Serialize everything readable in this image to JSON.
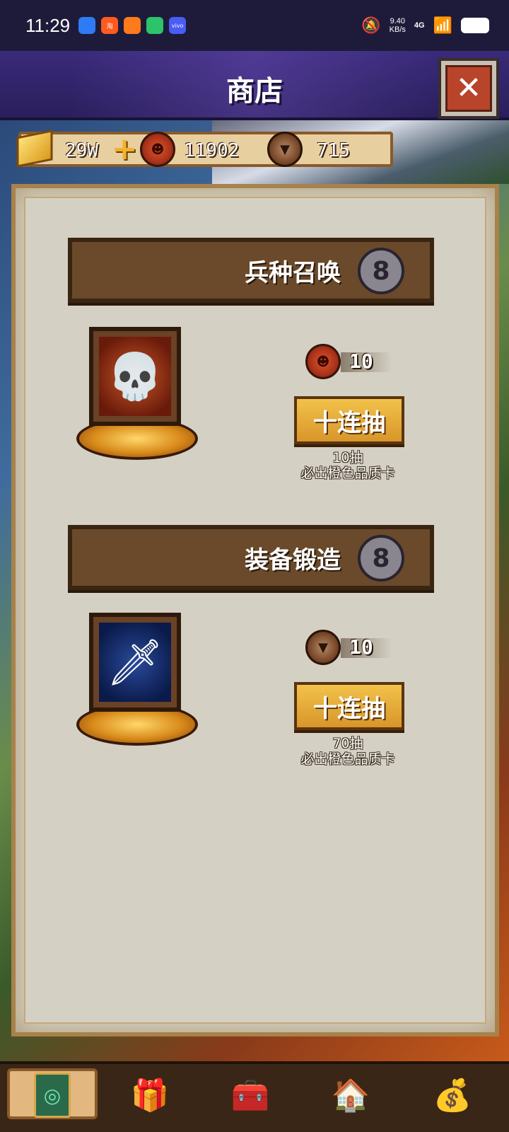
{
  "status_bar": {
    "time": "11:29",
    "apps": [
      {
        "name": "app-1",
        "color": "#2f7bf5",
        "label": ""
      },
      {
        "name": "taobao",
        "color": "#ff5a1f",
        "label": "淘"
      },
      {
        "name": "app-3",
        "color": "#ff7a1a",
        "label": ""
      },
      {
        "name": "app-4",
        "color": "#2cc36b",
        "label": ""
      },
      {
        "name": "vivo",
        "color": "#4a5cf5",
        "label": "vivo"
      }
    ],
    "net_speed_value": "9.40",
    "net_speed_unit": "KB/s",
    "network": "4G"
  },
  "header": {
    "title": "商店",
    "close_glyph": "✕"
  },
  "currency": {
    "gold": "29W",
    "plus": "+",
    "summon_tokens": "11902",
    "forge_tokens": "715"
  },
  "sections": [
    {
      "title": "兵种召唤",
      "info_glyph": "8",
      "item_icon": "skeleton-icon",
      "cost_icon": "summon-token-icon",
      "cost": "10",
      "button_label": "十连抽",
      "note_line1": "10抽",
      "note_line2": "必出橙色品质卡"
    },
    {
      "title": "装备锻造",
      "info_glyph": "8",
      "item_icon": "sword-icon",
      "cost_icon": "forge-token-icon",
      "cost": "10",
      "button_label": "十连抽",
      "note_line1": "70抽",
      "note_line2": "必出橙色品质卡"
    }
  ],
  "bottom_nav": [
    {
      "name": "cards",
      "icon": "card-icon",
      "active": true
    },
    {
      "name": "gift",
      "icon": "gift-icon"
    },
    {
      "name": "chest",
      "icon": "treasure-chest-icon"
    },
    {
      "name": "house",
      "icon": "house-icon"
    },
    {
      "name": "vip",
      "icon": "money-bag-icon"
    }
  ],
  "colors": {
    "title_bar": "#2a1f5c",
    "panel": "#d4d0c4",
    "header_wood": "#6a4a2a",
    "button_gold": "#f2c24a"
  }
}
